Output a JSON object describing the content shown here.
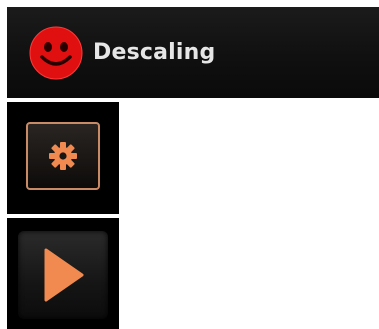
{
  "status": {
    "label": "Descaling",
    "icon": "happy-face-icon",
    "icon_color": "#e01010",
    "text_color": "#e6e6e6"
  },
  "settings": {
    "icon": "gear-icon",
    "accent_color": "#f08a50",
    "border_color": "#c98a66"
  },
  "play": {
    "icon": "play-icon",
    "accent_color": "#f08a50"
  }
}
